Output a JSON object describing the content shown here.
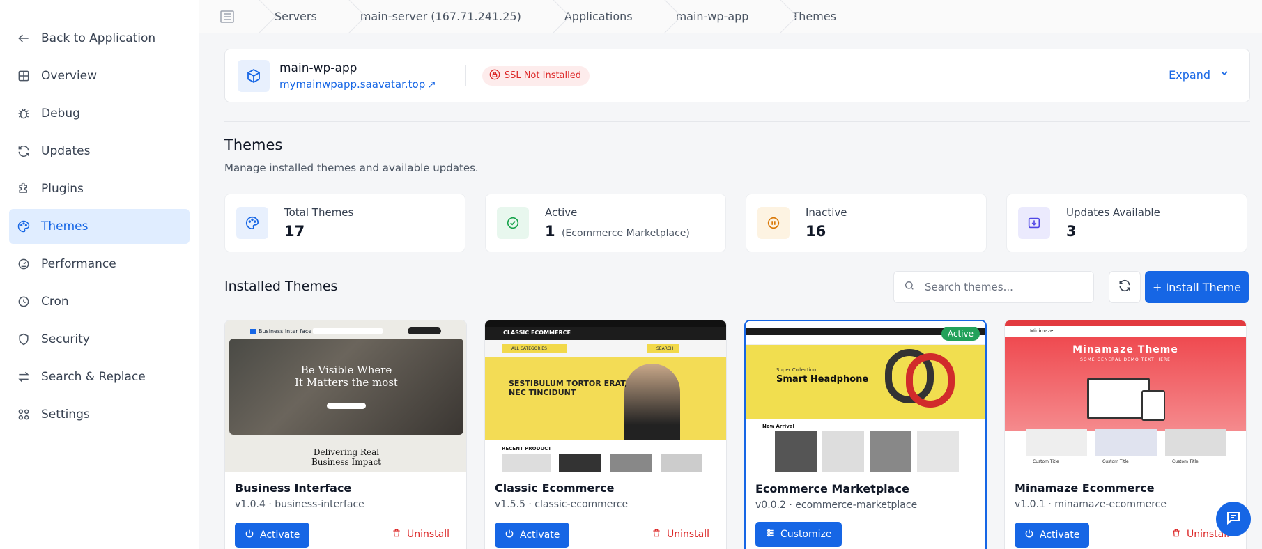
{
  "sidebar": {
    "items": [
      {
        "label": "Back to Application",
        "icon": "arrow-left-icon"
      },
      {
        "label": "Overview",
        "icon": "grid-icon"
      },
      {
        "label": "Debug",
        "icon": "bug-icon"
      },
      {
        "label": "Updates",
        "icon": "refresh-icon"
      },
      {
        "label": "Plugins",
        "icon": "puzzle-icon"
      },
      {
        "label": "Themes",
        "icon": "palette-icon",
        "active": true
      },
      {
        "label": "Performance",
        "icon": "gauge-icon"
      },
      {
        "label": "Cron",
        "icon": "clock-icon"
      },
      {
        "label": "Security",
        "icon": "shield-icon"
      },
      {
        "label": "Search & Replace",
        "icon": "swap-icon"
      },
      {
        "label": "Settings",
        "icon": "settings-icon"
      }
    ]
  },
  "breadcrumb": {
    "items": [
      "Servers",
      "main-server (167.71.241.25)",
      "Applications",
      "main-wp-app",
      "Themes"
    ]
  },
  "app": {
    "name": "main-wp-app",
    "url": "mymainwpapp.saavatar.top",
    "ssl_status": "SSL Not Installed",
    "expand_label": "Expand"
  },
  "page": {
    "title": "Themes",
    "subtitle": "Manage installed themes and available updates."
  },
  "stats": {
    "total": {
      "label": "Total Themes",
      "value": "17"
    },
    "active": {
      "label": "Active",
      "value": "1",
      "note": "(Ecommerce Marketplace)"
    },
    "inactive": {
      "label": "Inactive",
      "value": "16"
    },
    "updates": {
      "label": "Updates Available",
      "value": "3"
    }
  },
  "installed": {
    "title": "Installed Themes",
    "search_placeholder": "Search themes...",
    "install_label": "+ Install Theme"
  },
  "themes": [
    {
      "name": "Business Interface",
      "version": "v1.0.4 · business-interface",
      "action": "Activate",
      "uninstall": "Uninstall",
      "thumb": {
        "brand": "Business Inter face",
        "hero1": "Be Visible Where",
        "hero2": "It Matters the most",
        "lower1": "Delivering Real",
        "lower2": "Business Impact"
      }
    },
    {
      "name": "Classic Ecommerce",
      "version": "v1.5.5 · classic-ecommerce",
      "action": "Activate",
      "uninstall": "Uninstall",
      "thumb": {
        "brand": "CLASSIC ECOMMERCE",
        "categories": "ALL CATEGORIES",
        "search": "SEARCH",
        "hero1": "SESTIBULUM TORTOR ERAT,",
        "hero2": "NEC TINCIDUNT",
        "recent": "RECENT PRODUCT"
      }
    },
    {
      "name": "Ecommerce Marketplace",
      "version": "v0.0.2 · ecommerce-marketplace",
      "action": "Customize",
      "badge": "Active",
      "thumb": {
        "hero_small": "Super Collection",
        "hero": "Smart Headphone",
        "new_arrival": "New Arrival"
      }
    },
    {
      "name": "Minamaze Ecommerce",
      "version": "v1.0.1 · minamaze-ecommerce",
      "action": "Activate",
      "uninstall": "Uninstall",
      "thumb": {
        "brand": "Minimaze",
        "hero": "Minamaze Theme",
        "sub": "SOME GENERAL DEMO TEXT HERE",
        "p1": "Custom Title",
        "p2": "Custom Title",
        "p3": "Custom Title"
      }
    }
  ],
  "colors": {
    "accent": "#1666e5",
    "danger": "#dc2626",
    "success": "#22a15a"
  }
}
